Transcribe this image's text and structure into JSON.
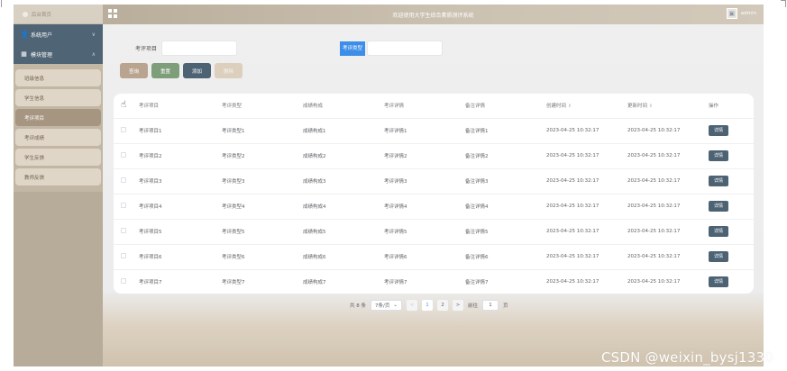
{
  "sidebar": {
    "home_label": "后台首页",
    "groups": [
      {
        "label": "系统用户",
        "icon": "user-icon",
        "chevron": "∨"
      },
      {
        "label": "模块管理",
        "icon": "grid-icon",
        "chevron": "∧"
      }
    ],
    "items": [
      {
        "label": "班级信息"
      },
      {
        "label": "学生信息"
      },
      {
        "label": "考评项目"
      },
      {
        "label": "考评成绩"
      },
      {
        "label": "学生反馈"
      },
      {
        "label": "教师反馈"
      }
    ],
    "active_item": "考评项目"
  },
  "header": {
    "title": "欢迎使用大学生综合素质测评系统",
    "user": "admin"
  },
  "search": {
    "item_label": "考评项目",
    "type_label": "考评类型",
    "item_value": "",
    "type_value": ""
  },
  "toolbar": {
    "search_label": "查询",
    "reset_label": "重置",
    "add_label": "添加",
    "delete_label": "删除"
  },
  "table": {
    "headers": [
      "考评项目",
      "考评类型",
      "成绩构成",
      "考评详情",
      "备注详情",
      "创建时间",
      "更新时间",
      "操作"
    ],
    "rows": [
      [
        "考评项目1",
        "考评类型1",
        "成绩构成1",
        "考评详情1",
        "备注详情1",
        "2023-04-25 10:32:17",
        "2023-04-25 10:32:17",
        "详情"
      ],
      [
        "考评项目2",
        "考评类型2",
        "成绩构成2",
        "考评详情2",
        "备注详情2",
        "2023-04-25 10:32:17",
        "2023-04-25 10:32:17",
        "详情"
      ],
      [
        "考评项目3",
        "考评类型3",
        "成绩构成3",
        "考评详情3",
        "备注详情3",
        "2023-04-25 10:32:17",
        "2023-04-25 10:32:17",
        "详情"
      ],
      [
        "考评项目4",
        "考评类型4",
        "成绩构成4",
        "考评详情4",
        "备注详情4",
        "2023-04-25 10:32:17",
        "2023-04-25 10:32:17",
        "详情"
      ],
      [
        "考评项目5",
        "考评类型5",
        "成绩构成5",
        "考评详情5",
        "备注详情5",
        "2023-04-25 10:32:17",
        "2023-04-25 10:32:17",
        "详情"
      ],
      [
        "考评项目6",
        "考评类型6",
        "成绩构成6",
        "考评详情6",
        "备注详情6",
        "2023-04-25 10:32:17",
        "2023-04-25 10:32:17",
        "详情"
      ],
      [
        "考评项目7",
        "考评类型7",
        "成绩构成7",
        "考评详情7",
        "备注详情7",
        "2023-04-25 10:32:17",
        "2023-04-25 10:32:17",
        "详情"
      ]
    ],
    "sort_glyph": "⇕"
  },
  "pagination": {
    "total_label": "共 8 条",
    "page_size": "7条/页",
    "prev": "<",
    "next": ">",
    "pages": [
      "1",
      "2"
    ],
    "current_page": "1",
    "goto_label": "前往",
    "goto_value": "1",
    "page_unit": "页"
  },
  "watermark": "CSDN @weixin_bysj1330",
  "colors": {
    "sidebar_bg": "#b7ab9a",
    "menu_bg": "#4f6475",
    "active_item": "#a69580",
    "search_btn": "#b9a58f",
    "reset_btn": "#7e9e7a",
    "add_btn": "#4d6374",
    "type_label_bg": "#3d8ee8"
  }
}
